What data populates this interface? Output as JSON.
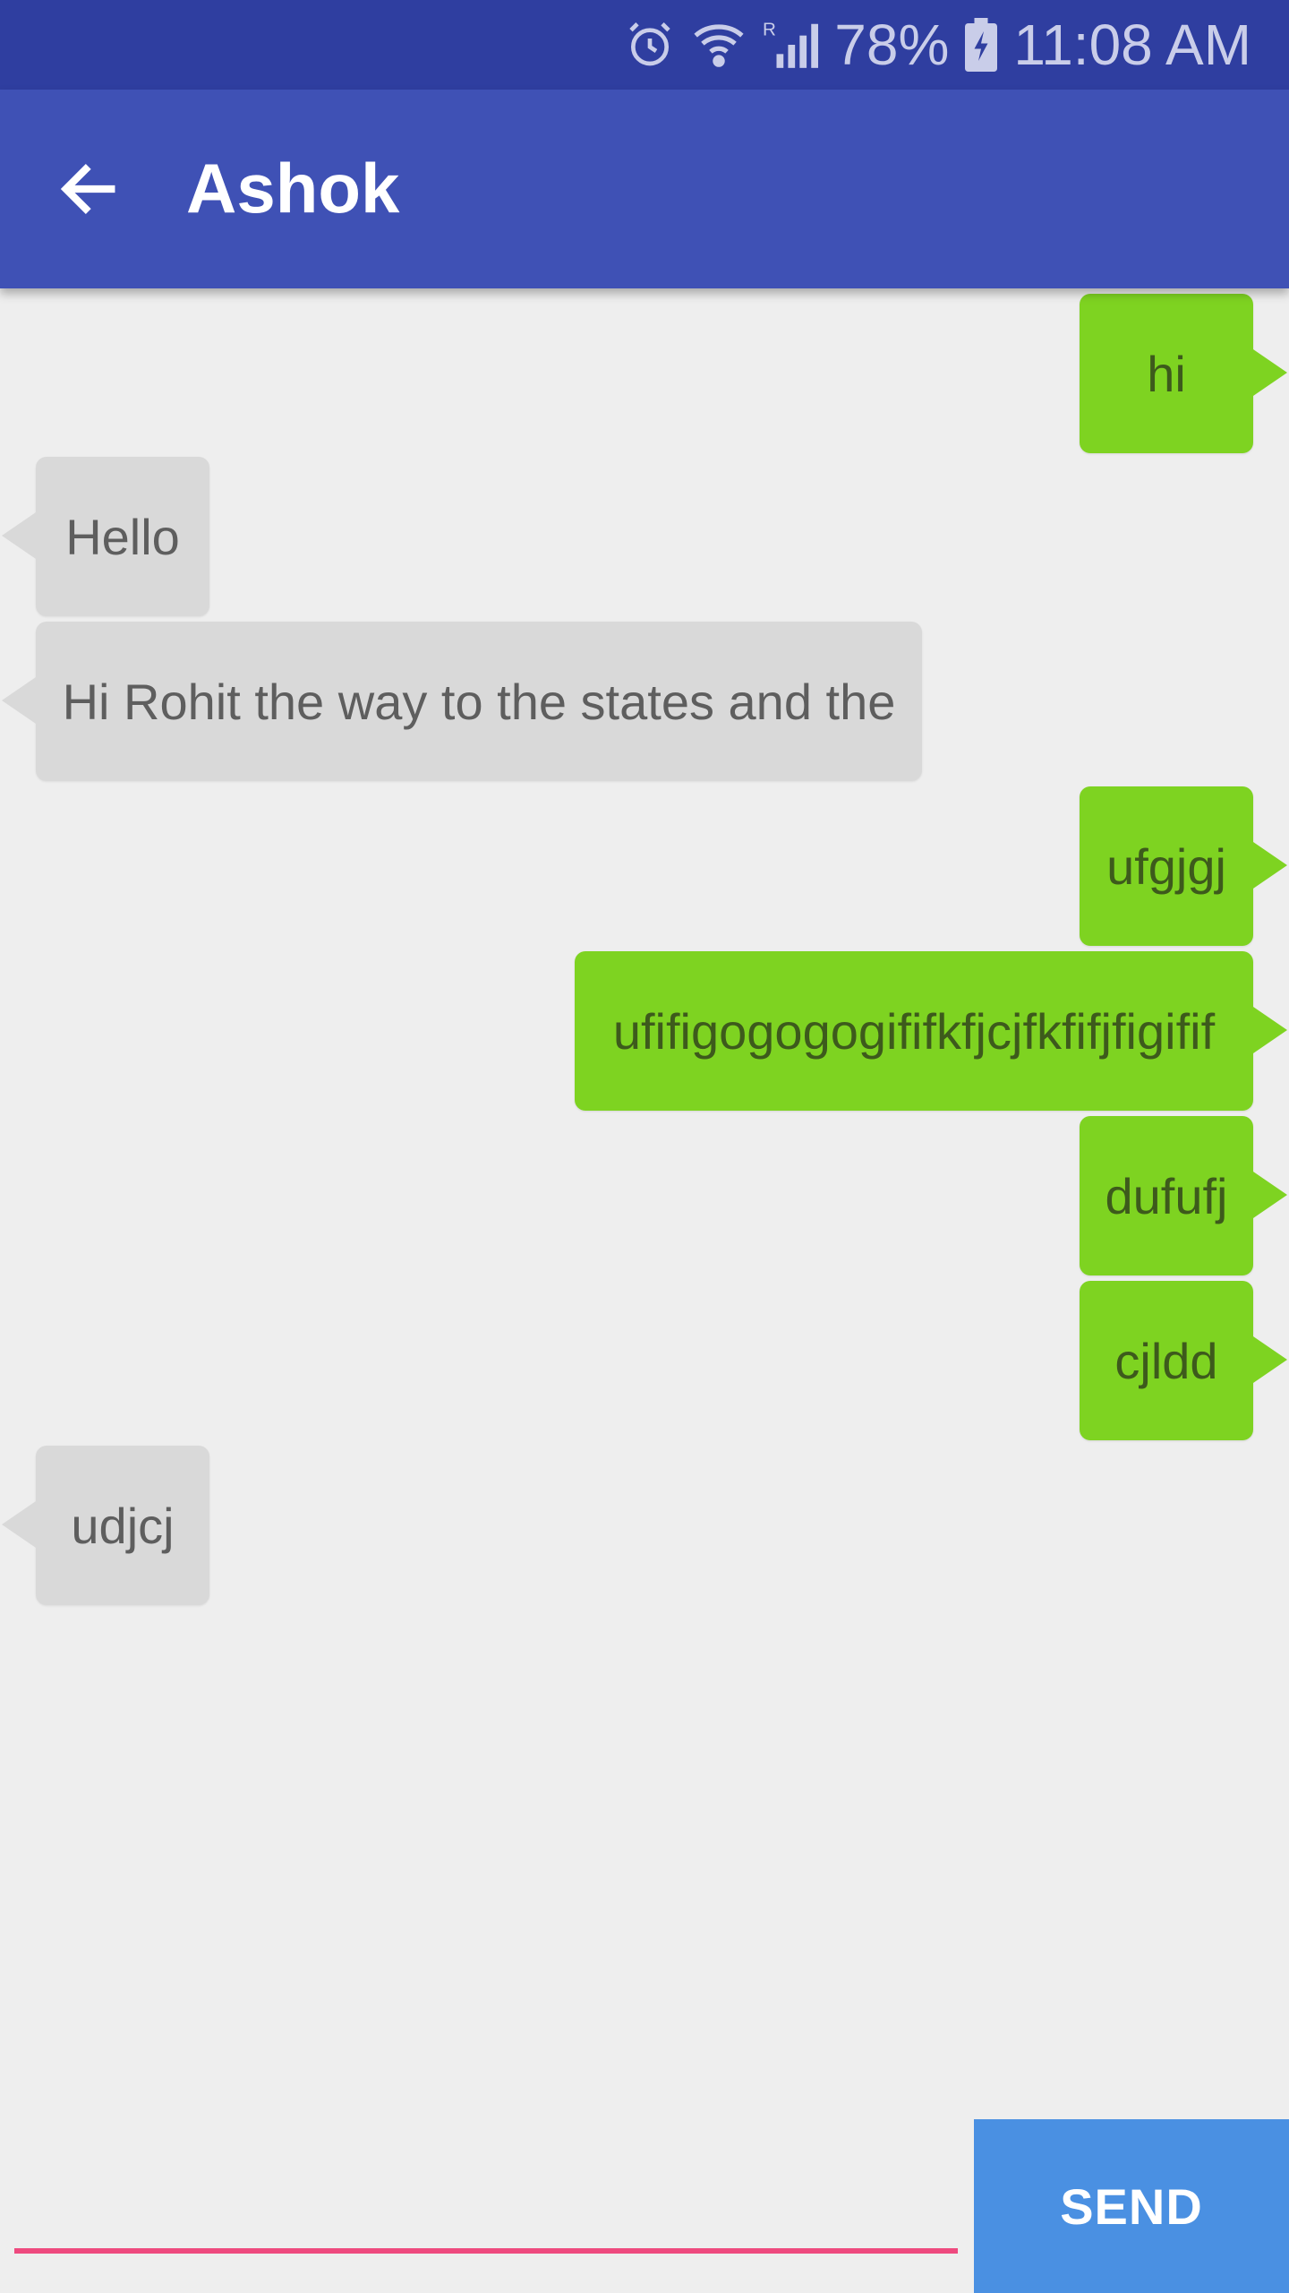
{
  "status_bar": {
    "battery": "78%",
    "time": "11:08 AM",
    "icons": [
      "alarm-icon",
      "wifi-icon",
      "signal-icon",
      "battery-charging-icon"
    ]
  },
  "header": {
    "title": "Ashok",
    "back_icon": "back-arrow-icon",
    "color": "#3f51b5"
  },
  "messages": [
    {
      "text": "hi",
      "direction": "outgoing"
    },
    {
      "text": "Hello",
      "direction": "incoming"
    },
    {
      "text": "Hi Rohit the way to the states and the",
      "direction": "incoming"
    },
    {
      "text": "ufgjgj",
      "direction": "outgoing"
    },
    {
      "text": "ufifigogogogififkfjcjfkfifjfigifif",
      "direction": "outgoing"
    },
    {
      "text": "dufufj",
      "direction": "outgoing"
    },
    {
      "text": "cjldd",
      "direction": "outgoing"
    },
    {
      "text": "udjcj",
      "direction": "incoming"
    }
  ],
  "composer": {
    "placeholder": "",
    "value": "",
    "send_label": "SEND"
  },
  "colors": {
    "outgoing_bubble": "#7ed321",
    "incoming_bubble": "#d9d9d9",
    "send_button": "#4a90e2",
    "input_underline": "#ee4a7f"
  }
}
